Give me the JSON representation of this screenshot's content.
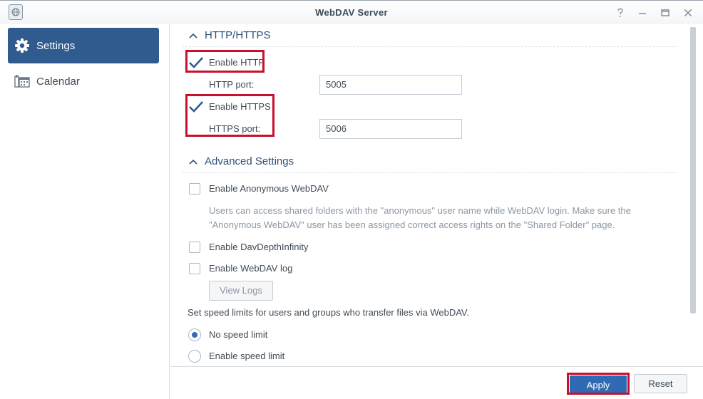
{
  "window": {
    "title": "WebDAV Server",
    "icons": [
      "app-globe-icon",
      "help-icon",
      "minimize-icon",
      "maximize-icon",
      "close-icon"
    ]
  },
  "sidebar": {
    "items": [
      {
        "label": "Settings",
        "icon": "gear-icon",
        "active": true
      },
      {
        "label": "Calendar",
        "icon": "calendar-icon",
        "active": false
      }
    ]
  },
  "http_section": {
    "title": "HTTP/HTTPS",
    "enable_http_label": "Enable HTTP",
    "http_port_label": "HTTP port:",
    "http_port_value": "5005",
    "enable_https_label": "Enable HTTPS",
    "https_port_label": "HTTPS port:",
    "https_port_value": "5006"
  },
  "advanced_section": {
    "title": "Advanced Settings",
    "anonymous_label": "Enable Anonymous WebDAV",
    "anonymous_desc": "Users can access shared folders with the \"anonymous\" user name while WebDAV login. Make sure the \"Anonymous WebDAV\" user has been assigned correct access rights on the \"Shared Folder\" page.",
    "davdepth_label": "Enable DavDepthInfinity",
    "log_label": "Enable WebDAV log",
    "view_logs_label": "View Logs",
    "speed_intro": "Set speed limits for users and groups who transfer files via WebDAV.",
    "no_speed_label": "No speed limit",
    "enable_speed_label": "Enable speed limit"
  },
  "footer": {
    "apply_label": "Apply",
    "reset_label": "Reset"
  },
  "colors": {
    "accent": "#2f5b8f",
    "apply": "#2e6bb3",
    "highlight": "#c8102e",
    "check": "#2f5b8f"
  }
}
